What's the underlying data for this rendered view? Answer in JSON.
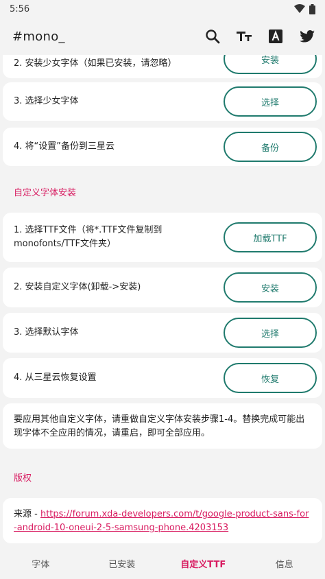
{
  "status": {
    "time": "5:56"
  },
  "app_bar": {
    "title": "#mono_"
  },
  "top_cards": [
    {
      "text": "2. 安装少女字体（如果已安装，请忽略）",
      "button": "安装"
    },
    {
      "text": "3. 选择少女字体",
      "button": "选择"
    },
    {
      "text": "4. 将“设置”备份到三星云",
      "button": "备份"
    }
  ],
  "custom_section": {
    "title": "自定义字体安装",
    "cards": [
      {
        "text": "1. 选择TTF文件（将*.TTF文件复制到monofonts/TTF文件夹）",
        "button": "加载TTF"
      },
      {
        "text": "2. 安装自定义字体(卸载->安装)",
        "button": "安装"
      },
      {
        "text": "3. 选择默认字体",
        "button": "选择"
      },
      {
        "text": "4. 从三星云恢复设置",
        "button": "恢复"
      }
    ],
    "note": "要应用其他自定义字体，请重做自定义字体安装步骤1-4。替换完成可能出现字体不全应用的情况，请重启，即可全部应用。"
  },
  "copyright": {
    "title": "版权",
    "source_label": "来源 - ",
    "link": "https://forum.xda-developers.com/t/google-product-sans-for-android-10-oneui-2-5-samsung-phone.4203153"
  },
  "bottom_nav": [
    {
      "label": "字体",
      "active": false
    },
    {
      "label": "已安装",
      "active": false
    },
    {
      "label": "自定义TTF",
      "active": true
    },
    {
      "label": "信息",
      "active": false
    }
  ],
  "colors": {
    "accent": "#d81b60",
    "button": "#1f7a6d",
    "background": "#f3f3f3",
    "card": "#ffffff"
  },
  "icons": [
    "wifi-icon",
    "battery-icon",
    "search-icon",
    "text-size-icon",
    "font-icon",
    "twitter-icon"
  ]
}
